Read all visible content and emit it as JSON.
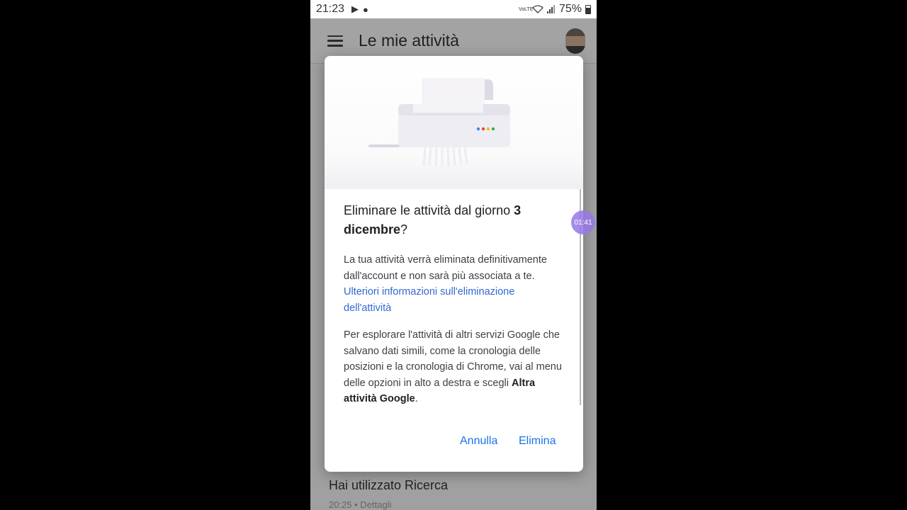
{
  "status_bar": {
    "time": "21:23",
    "network_label": "VoLTE",
    "battery": "75%"
  },
  "app_bar": {
    "title": "Le mie attività"
  },
  "background_item": {
    "title": "Hai utilizzato Ricerca",
    "subtitle": "20:25 • Dettagli"
  },
  "overlay_bubble": "01:41",
  "dialog": {
    "title_prefix": "Eliminare le attività dal giorno ",
    "title_date_line1": "3",
    "title_date_line2": "dicembre",
    "title_suffix": "?",
    "paragraph1_text": "La tua attività verrà eliminata definitivamente dall'account e non sarà più associata a te. ",
    "paragraph1_link": "Ulteriori informazioni sull'eliminazione dell'attività",
    "paragraph2_text": "Per esplorare l'attività di altri servizi Google che salvano dati simili, come la cronologia delle posizioni e la cronologia di Chrome, vai al menu delle opzioni in alto a destra e scegli ",
    "paragraph2_bold": "Altra attività Google",
    "paragraph2_end": ".",
    "cancel_label": "Annulla",
    "delete_label": "Elimina"
  },
  "colors": {
    "accent": "#1a73e8",
    "link": "#3367d6",
    "google_dots": [
      "#4285f4",
      "#ea4335",
      "#fbbc05",
      "#34a853"
    ]
  }
}
